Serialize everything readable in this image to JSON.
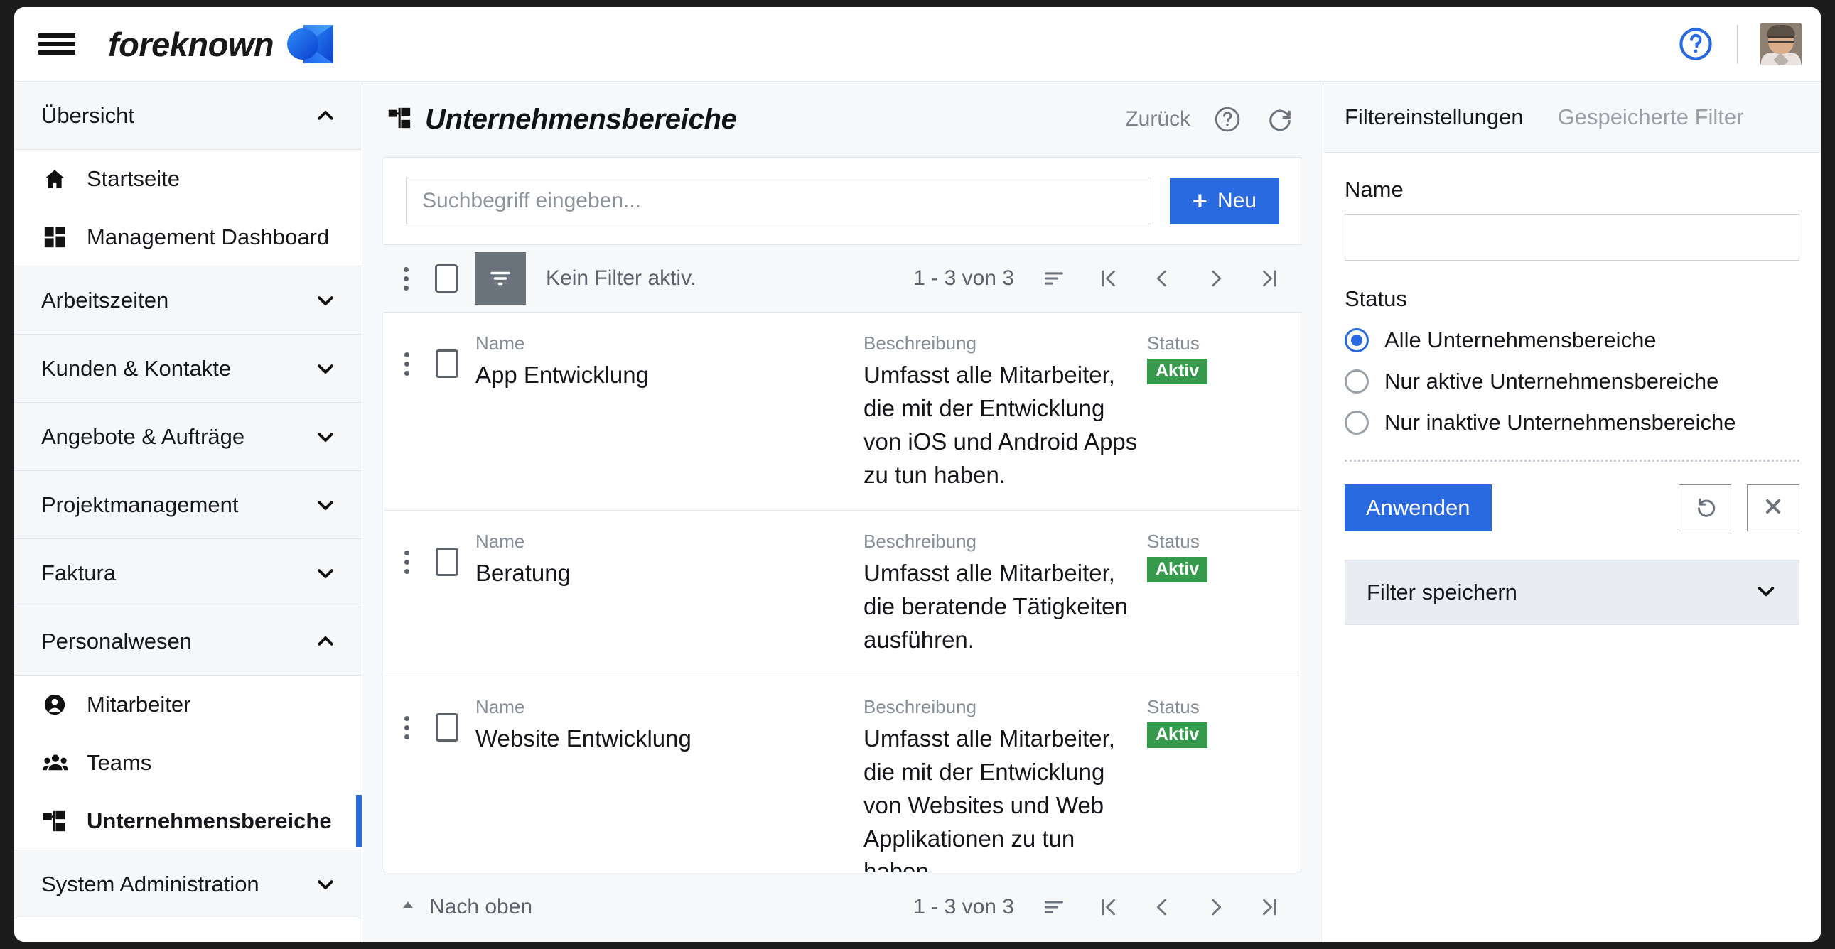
{
  "topbar": {
    "menu_icon": "hamburger-icon",
    "brand": "foreknown",
    "logo_icon": "foreknown-logo",
    "help_icon": "help-circle-icon",
    "avatar_icon": "user-avatar"
  },
  "sidebar": {
    "groups": [
      {
        "label": "Übersicht",
        "expanded": true,
        "chevron": "chevron-up-icon",
        "items": [
          {
            "label": "Startseite",
            "icon": "home-icon",
            "active": false
          },
          {
            "label": "Management Dashboard",
            "icon": "dashboard-icon",
            "active": false
          }
        ]
      },
      {
        "label": "Arbeitszeiten",
        "expanded": false,
        "chevron": "chevron-down-icon",
        "items": []
      },
      {
        "label": "Kunden & Kontakte",
        "expanded": false,
        "chevron": "chevron-down-icon",
        "items": []
      },
      {
        "label": "Angebote & Aufträge",
        "expanded": false,
        "chevron": "chevron-down-icon",
        "items": []
      },
      {
        "label": "Projektmanagement",
        "expanded": false,
        "chevron": "chevron-down-icon",
        "items": []
      },
      {
        "label": "Faktura",
        "expanded": false,
        "chevron": "chevron-down-icon",
        "items": []
      },
      {
        "label": "Personalwesen",
        "expanded": true,
        "chevron": "chevron-up-icon",
        "items": [
          {
            "label": "Mitarbeiter",
            "icon": "person-icon",
            "active": false
          },
          {
            "label": "Teams",
            "icon": "people-icon",
            "active": false
          },
          {
            "label": "Unternehmensbereiche",
            "icon": "org-chart-icon",
            "active": true
          }
        ]
      },
      {
        "label": "System Administration",
        "expanded": false,
        "chevron": "chevron-down-icon",
        "items": []
      }
    ]
  },
  "main": {
    "page_icon": "org-chart-icon",
    "title": "Unternehmensbereiche",
    "back_label": "Zurück",
    "help_icon": "help-circle-icon",
    "refresh_icon": "refresh-icon",
    "search_placeholder": "Suchbegriff eingeben...",
    "search_value": "",
    "new_button_label": "Neu",
    "new_button_icon": "plus-icon",
    "toolbar": {
      "kebab_icon": "kebab-menu-icon",
      "select_all_checkbox": false,
      "filter_icon": "filter-icon",
      "filter_status": "Kein Filter aktiv.",
      "page_count": "1 - 3 von 3",
      "sort_icon": "sort-icon",
      "first_icon": "first-page-icon",
      "prev_icon": "prev-page-icon",
      "next_icon": "next-page-icon",
      "last_icon": "last-page-icon"
    },
    "columns": {
      "name": "Name",
      "description": "Beschreibung",
      "status": "Status"
    },
    "rows": [
      {
        "name": "App Entwicklung",
        "description": "Umfasst alle Mitarbeiter, die mit der Entwicklung von iOS und Android Apps zu tun haben.",
        "status": "Aktiv",
        "checked": false
      },
      {
        "name": "Beratung",
        "description": "Umfasst alle Mitarbeiter, die beratende Tätigkeiten ausführen.",
        "status": "Aktiv",
        "checked": false
      },
      {
        "name": "Website Entwicklung",
        "description": "Umfasst alle Mitarbeiter, die mit der Entwicklung von Websites und Web Applikationen zu tun haben.",
        "status": "Aktiv",
        "checked": false
      }
    ],
    "footer": {
      "to_top_label": "Nach oben",
      "to_top_icon": "caret-up-icon",
      "page_count": "1 - 3 von 3",
      "sort_icon": "sort-icon",
      "first_icon": "first-page-icon",
      "prev_icon": "prev-page-icon",
      "next_icon": "next-page-icon",
      "last_icon": "last-page-icon"
    }
  },
  "filter_panel": {
    "tab_settings": "Filtereinstellungen",
    "tab_saved": "Gespeicherte Filter",
    "name_label": "Name",
    "name_value": "",
    "status_label": "Status",
    "status_options": [
      {
        "label": "Alle Unternehmensbereiche",
        "selected": true
      },
      {
        "label": "Nur aktive Unternehmensbereiche",
        "selected": false
      },
      {
        "label": "Nur inaktive Unternehmensbereiche",
        "selected": false
      }
    ],
    "apply_label": "Anwenden",
    "reset_icon": "undo-icon",
    "clear_icon": "close-x-icon",
    "save_filter_label": "Filter speichern",
    "save_filter_chevron": "chevron-down-icon"
  },
  "colors": {
    "accent": "#2a6ae0",
    "status_active": "#359a4b",
    "sidebar_group_bg": "#f6f7f9",
    "main_bg": "#f7f8fa",
    "muted_text": "#5c636d"
  }
}
